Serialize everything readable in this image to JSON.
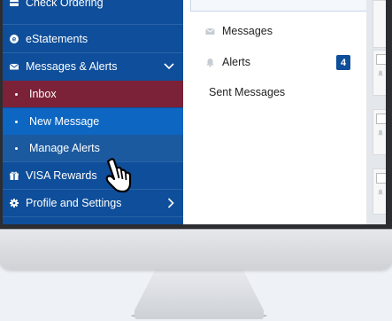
{
  "sidebar": {
    "items": [
      {
        "label": "Check Ordering",
        "icon": "card-icon"
      },
      {
        "label": "eStatements",
        "icon": "e-circle-icon"
      },
      {
        "label": "Messages & Alerts",
        "icon": "envelope-icon",
        "chevron": "∨"
      },
      {
        "label": "Inbox",
        "active": true
      },
      {
        "label": "New Message"
      },
      {
        "label": "Manage Alerts",
        "hover": true
      },
      {
        "label": "VISA Rewards",
        "icon": "gift-icon"
      },
      {
        "label": "Profile and Settings",
        "icon": "gear-icon",
        "chevron": "›"
      }
    ]
  },
  "messages_panel": {
    "items": [
      {
        "label": "Messages",
        "icon": "envelope-icon"
      },
      {
        "label": "Alerts",
        "icon": "bell-icon",
        "badge": "4"
      },
      {
        "label": "Sent Messages"
      }
    ]
  },
  "colors": {
    "sidebar": "#0e4e9a",
    "inbox_active": "#7b2238",
    "new_message": "#0c66c2",
    "manage_alerts_hover": "#1c5a9f",
    "badge": "#0e4e9a"
  }
}
